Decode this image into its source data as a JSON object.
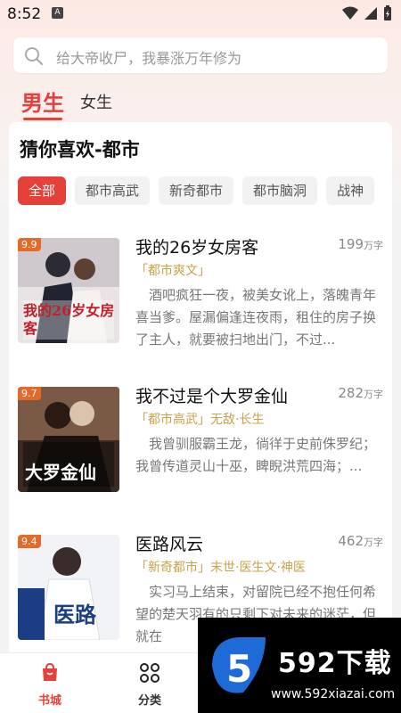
{
  "status_bar": {
    "time": "8:52",
    "app_icon": "A"
  },
  "search": {
    "placeholder": "给大帝收尸，我暴涨万年修为"
  },
  "tabs": [
    {
      "label": "男生",
      "active": true
    },
    {
      "label": "女生",
      "active": false
    }
  ],
  "section": {
    "title": "猜你喜欢-都市",
    "chips": [
      "全部",
      "都市高武",
      "新奇都市",
      "都市脑洞",
      "战神"
    ]
  },
  "books": [
    {
      "title": "我的26岁女房客",
      "rating": "9.9",
      "count_num": "199",
      "count_unit": "万字",
      "tags": "「都市爽文」",
      "desc": "酒吧疯狂一夜，被美女讹上，落魄青年喜当爹。屋漏偏逢连夜雨，租住的房子换了主人，就要被扫地出门，不过...",
      "cover_text": "我的26岁女房客"
    },
    {
      "title": "我不过是个大罗金仙",
      "rating": "9.7",
      "count_num": "282",
      "count_unit": "万字",
      "tags": "「都市高武」无敌·长生",
      "desc": "我曾驯服霸王龙，徜徉于史前侏罗纪；我曾传道灵山十巫，睥睨洪荒四海；...",
      "cover_text": "大罗金仙"
    },
    {
      "title": "医路风云",
      "rating": "9.4",
      "count_num": "462",
      "count_unit": "万字",
      "tags": "「新奇都市」末世·医生文·神医",
      "desc": "实习马上结束，对留院已经不抱任何希望的楚天羽有的只剩下对未来的迷茫，但就在",
      "cover_text": "医路"
    }
  ],
  "nav": [
    {
      "label": "书城",
      "active": true
    },
    {
      "label": "分类",
      "active": false
    }
  ],
  "watermark": {
    "brand": "592下载",
    "url": "www.592xiazai.com",
    "logo_char": "5"
  },
  "colors": {
    "accent": "#e5413a",
    "tag": "#c8a24a"
  }
}
